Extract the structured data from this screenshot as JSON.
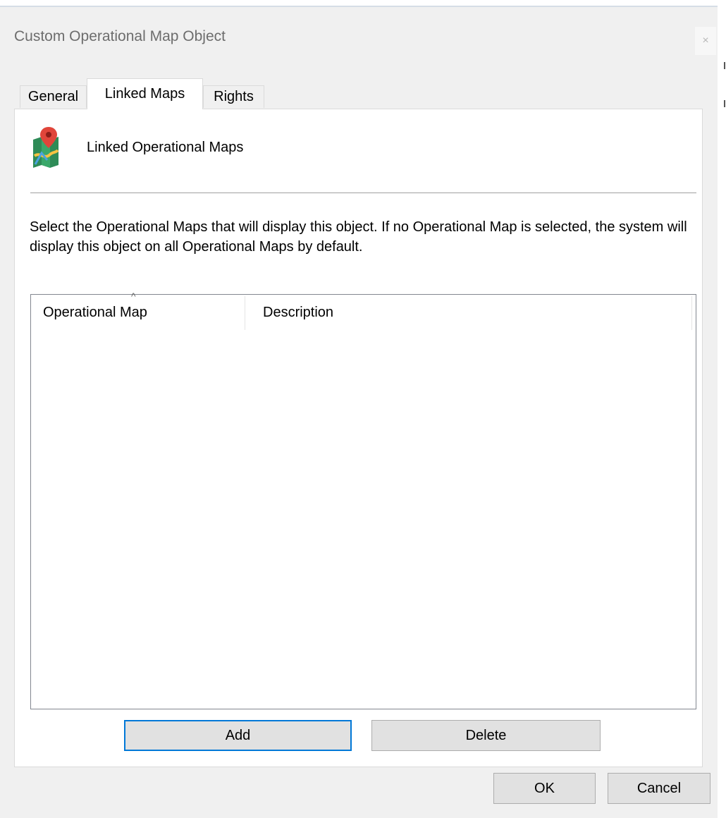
{
  "window": {
    "title": "Custom Operational Map Object",
    "close_glyph": "×"
  },
  "tabs": [
    {
      "label": "General",
      "active": false
    },
    {
      "label": "Linked Maps",
      "active": true
    },
    {
      "label": "Rights",
      "active": false
    }
  ],
  "panel": {
    "icon": "map-pin-icon",
    "heading": "Linked Operational Maps",
    "description": "Select the Operational Maps that will display this object. If no Operational Map is selected, the system will display this object on all Operational Maps by default."
  },
  "list": {
    "columns": [
      "Operational Map",
      "Description"
    ],
    "sort_indicator": "^",
    "rows": []
  },
  "panel_buttons": {
    "add": "Add",
    "delete": "Delete"
  },
  "dialog_buttons": {
    "ok": "OK",
    "cancel": "Cancel"
  },
  "colors": {
    "accent_border": "#0078d7",
    "dialog_bg": "#f0f0f0",
    "button_bg": "#e1e1e1"
  }
}
